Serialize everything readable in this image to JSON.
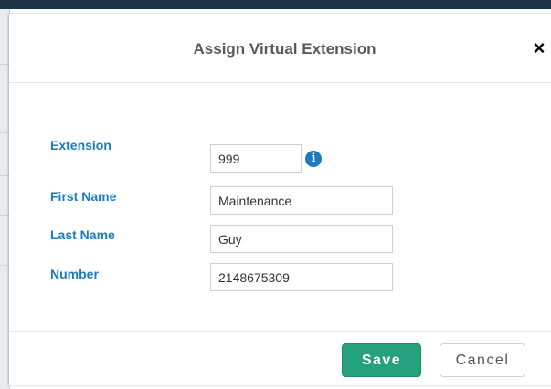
{
  "dialog": {
    "title": "Assign Virtual Extension",
    "close_glyph": "×"
  },
  "form": {
    "extension": {
      "label": "Extension",
      "value": "999"
    },
    "first_name": {
      "label": "First Name",
      "value": "Maintenance"
    },
    "last_name": {
      "label": "Last Name",
      "value": "Guy"
    },
    "number": {
      "label": "Number",
      "value": "2148675309"
    },
    "info_glyph": "i"
  },
  "footer": {
    "save_label": "Save",
    "cancel_label": "Cancel"
  },
  "colors": {
    "label_blue": "#1a7bbf",
    "save_green": "#26a17e",
    "top_bar": "#1f3346"
  },
  "icons": {
    "close": "close-icon",
    "info": "info-icon"
  }
}
